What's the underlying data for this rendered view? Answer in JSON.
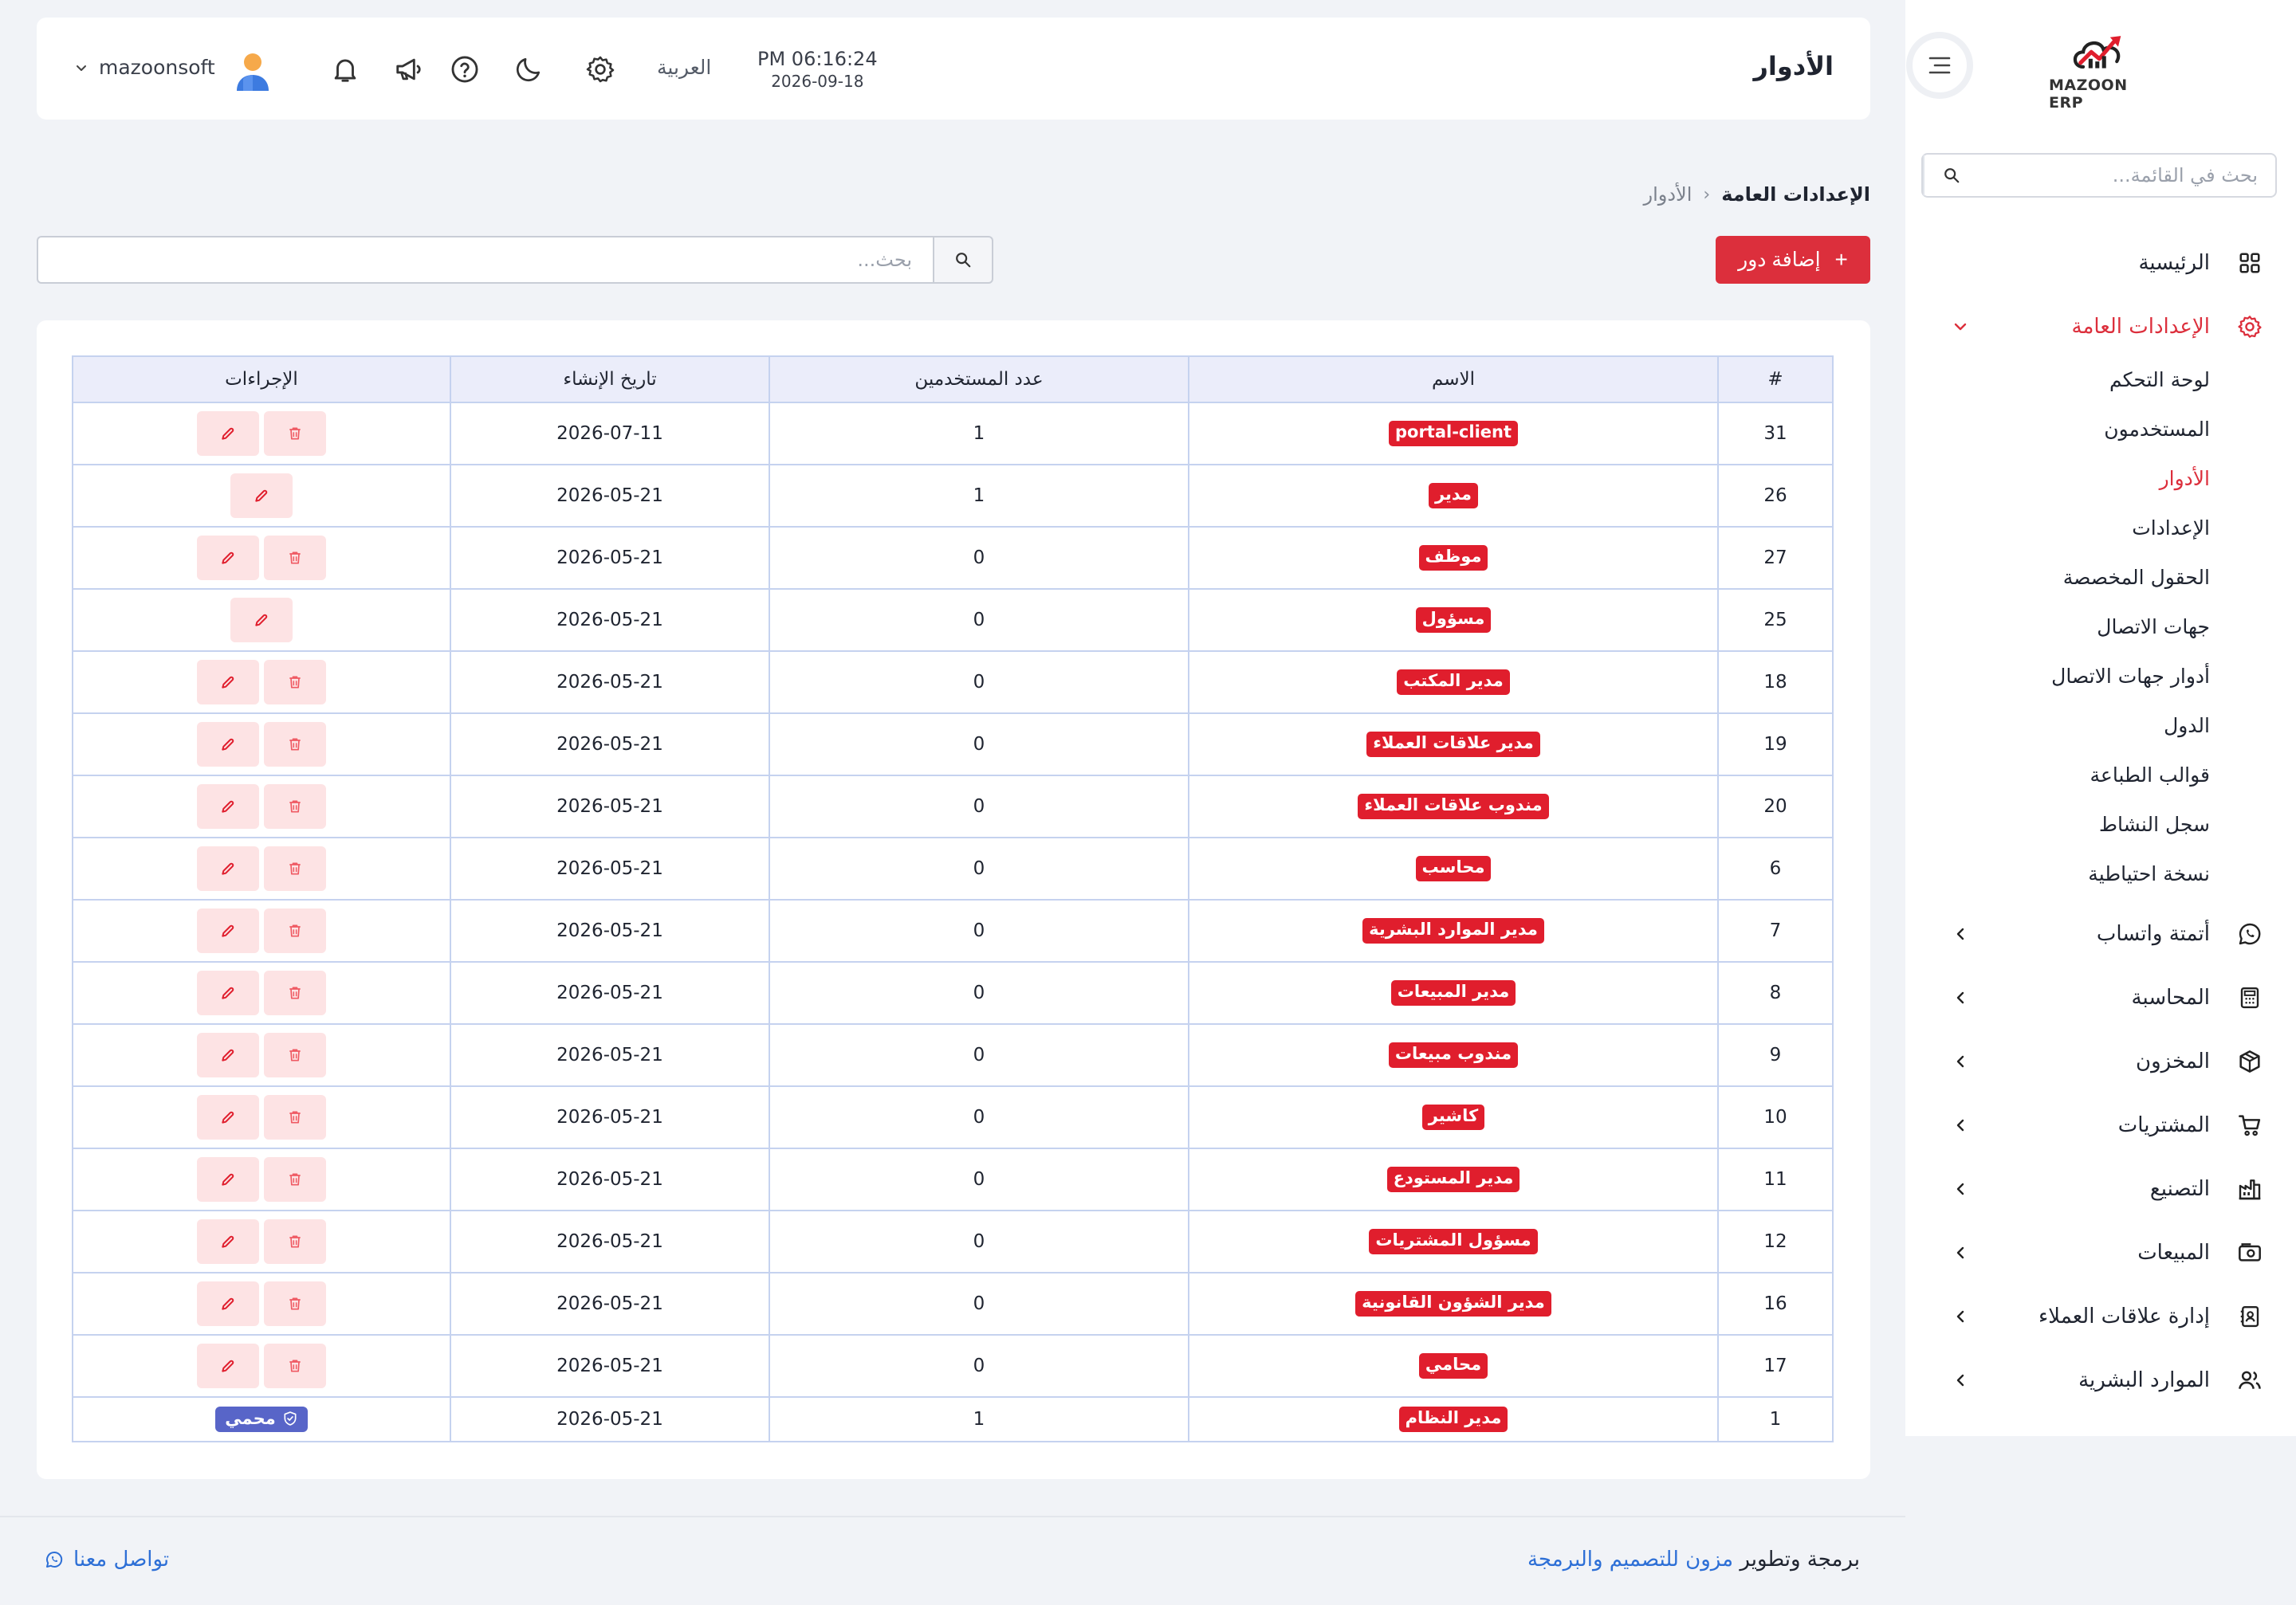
{
  "sidebar": {
    "logo_text": "MAZOON ERP",
    "logo_small": "ERP/ERP",
    "search_placeholder": "بحث في القائمة...",
    "menu": [
      {
        "label": "الرئيسية",
        "icon": "grid-icon"
      },
      {
        "label": "الإعدادات العامة",
        "icon": "gear-icon",
        "expanded": true
      },
      {
        "label": "أتمتة واتساب",
        "icon": "whatsapp-icon"
      },
      {
        "label": "المحاسبة",
        "icon": "calculator-icon"
      },
      {
        "label": "المخزون",
        "icon": "box-icon"
      },
      {
        "label": "المشتريات",
        "icon": "cart-icon"
      },
      {
        "label": "التصنيع",
        "icon": "factory-icon"
      },
      {
        "label": "المبيعات",
        "icon": "cash-register-icon"
      },
      {
        "label": "إدارة علاقات العملاء",
        "icon": "contacts-icon"
      },
      {
        "label": "الموارد البشرية",
        "icon": "users-icon"
      }
    ],
    "submenu": [
      {
        "label": "لوحة التحكم"
      },
      {
        "label": "المستخدمون"
      },
      {
        "label": "الأدوار",
        "active": true
      },
      {
        "label": "الإعدادات"
      },
      {
        "label": "الحقول المخصصة"
      },
      {
        "label": "جهات الاتصال"
      },
      {
        "label": "أدوار جهات الاتصال"
      },
      {
        "label": "الدول"
      },
      {
        "label": "قوالب الطباعة"
      },
      {
        "label": "سجل النشاط"
      },
      {
        "label": "نسخة احتياطية"
      }
    ]
  },
  "header": {
    "title": "الأدوار",
    "time": "PM 06:16:24",
    "date": "2026-09-18",
    "language": "العربية",
    "username": "mazoonsoft"
  },
  "breadcrumb": {
    "parent": "الإعدادات العامة",
    "separator": "‹",
    "current": "الأدوار"
  },
  "toolbar": {
    "add_label": "إضافة دور",
    "add_plus": "+",
    "search_placeholder": "بحث..."
  },
  "table": {
    "headers": {
      "id": "#",
      "name": "الاسم",
      "users": "عدد المستخدمين",
      "created": "تاريخ الإنشاء",
      "actions": "الإجراءات"
    },
    "rows": [
      {
        "id": "31",
        "name": "portal-client",
        "users": "1",
        "created": "2026-07-11",
        "actions": "edit-delete"
      },
      {
        "id": "26",
        "name": "مدير",
        "users": "1",
        "created": "2026-05-21",
        "actions": "edit"
      },
      {
        "id": "27",
        "name": "موظف",
        "users": "0",
        "created": "2026-05-21",
        "actions": "edit-delete"
      },
      {
        "id": "25",
        "name": "مسؤول",
        "users": "0",
        "created": "2026-05-21",
        "actions": "edit"
      },
      {
        "id": "18",
        "name": "مدير المكتب",
        "users": "0",
        "created": "2026-05-21",
        "actions": "edit-delete"
      },
      {
        "id": "19",
        "name": "مدير علاقات العملاء",
        "users": "0",
        "created": "2026-05-21",
        "actions": "edit-delete"
      },
      {
        "id": "20",
        "name": "مندوب علاقات العملاء",
        "users": "0",
        "created": "2026-05-21",
        "actions": "edit-delete"
      },
      {
        "id": "6",
        "name": "محاسب",
        "users": "0",
        "created": "2026-05-21",
        "actions": "edit-delete"
      },
      {
        "id": "7",
        "name": "مدير الموارد البشرية",
        "users": "0",
        "created": "2026-05-21",
        "actions": "edit-delete"
      },
      {
        "id": "8",
        "name": "مدير المبيعات",
        "users": "0",
        "created": "2026-05-21",
        "actions": "edit-delete"
      },
      {
        "id": "9",
        "name": "مندوب مبيعات",
        "users": "0",
        "created": "2026-05-21",
        "actions": "edit-delete"
      },
      {
        "id": "10",
        "name": "كاشير",
        "users": "0",
        "created": "2026-05-21",
        "actions": "edit-delete"
      },
      {
        "id": "11",
        "name": "مدير المستودع",
        "users": "0",
        "created": "2026-05-21",
        "actions": "edit-delete"
      },
      {
        "id": "12",
        "name": "مسؤول المشتريات",
        "users": "0",
        "created": "2026-05-21",
        "actions": "edit-delete"
      },
      {
        "id": "16",
        "name": "مدير الشؤون القانونية",
        "users": "0",
        "created": "2026-05-21",
        "actions": "edit-delete"
      },
      {
        "id": "17",
        "name": "محامي",
        "users": "0",
        "created": "2026-05-21",
        "actions": "edit-delete"
      },
      {
        "id": "1",
        "name": "مدير النظام",
        "users": "1",
        "created": "2026-05-21",
        "actions": "protected",
        "protected_label": "محمي"
      }
    ]
  },
  "footer": {
    "credit_prefix": "برمجة وتطوير",
    "credit_link": "مزون للتصميم والبرمجة",
    "contact": "تواصل معنا"
  },
  "colors": {
    "accent": "#dc2f3c",
    "badge": "#e01e2d",
    "protected": "#5865c8",
    "link": "#2d6fd6",
    "header_row": "#ebedfa"
  }
}
